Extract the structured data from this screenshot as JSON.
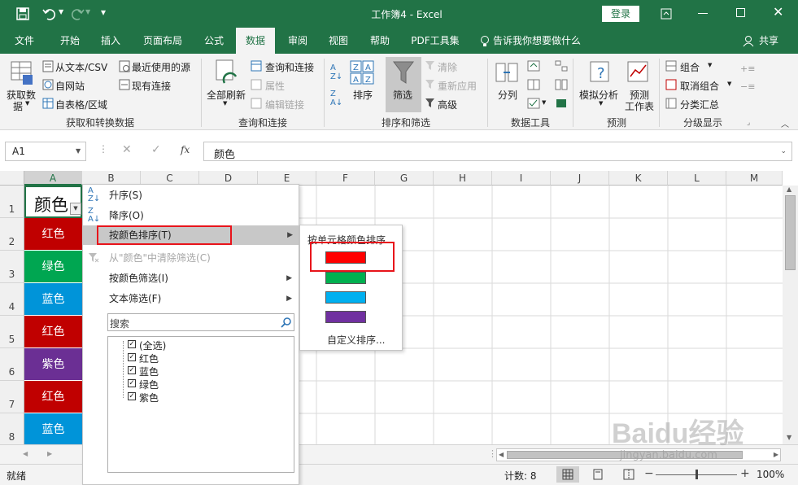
{
  "titlebar": {
    "title": "工作簿4 - Excel",
    "login": "登录"
  },
  "tabs": [
    "文件",
    "开始",
    "插入",
    "页面布局",
    "公式",
    "数据",
    "审阅",
    "视图",
    "帮助",
    "PDF工具集"
  ],
  "tell_me": "告诉我你想要做什么",
  "share": "共享",
  "ribbon": {
    "get_data": "获取数",
    "get_data2": "据",
    "from_text": "从文本/CSV",
    "from_web": "自网站",
    "from_table": "自表格/区域",
    "recent": "最近使用的源",
    "existing": "现有连接",
    "group1": "获取和转换数据",
    "refresh_all": "全部刷新",
    "queries": "查询和连接",
    "properties": "属性",
    "edit_links": "编辑链接",
    "group2": "查询和连接",
    "sort": "排序",
    "filter": "筛选",
    "clear": "清除",
    "reapply": "重新应用",
    "advanced": "高级",
    "group3": "排序和筛选",
    "split": "分列",
    "group4": "数据工具",
    "whatif": "模拟分析",
    "forecast": "预测",
    "forecast_sheet": "工作表",
    "group5": "预测",
    "group_btn": "组合",
    "ungroup": "取消组合",
    "subtotal": "分类汇总",
    "group6": "分级显示"
  },
  "formula_bar": {
    "name_box": "A1",
    "fx": "fx",
    "content": "颜色"
  },
  "columns": [
    "A",
    "B",
    "C",
    "D",
    "E",
    "F",
    "G",
    "H",
    "I",
    "J",
    "K",
    "L",
    "M"
  ],
  "rows": [
    "1",
    "2",
    "3",
    "4",
    "5",
    "6",
    "7",
    "8"
  ],
  "cells_a": [
    {
      "text": "颜色",
      "color": "#ffffff"
    },
    {
      "text": "红色",
      "color": "#c00000"
    },
    {
      "text": "绿色",
      "color": "#00a651"
    },
    {
      "text": "蓝色",
      "color": "#0094d9"
    },
    {
      "text": "红色",
      "color": "#c00000"
    },
    {
      "text": "紫色",
      "color": "#6b2f94"
    },
    {
      "text": "红色",
      "color": "#c00000"
    },
    {
      "text": "蓝色",
      "color": "#0094d9"
    }
  ],
  "menu": {
    "sort_asc": "升序(S)",
    "sort_desc": "降序(O)",
    "sort_by_color": "按颜色排序(T)",
    "clear_filter": "从\"颜色\"中清除筛选(C)",
    "filter_by_color": "按颜色筛选(I)",
    "text_filter": "文本筛选(F)",
    "search_placeholder": "搜索",
    "items": [
      "(全选)",
      "红色",
      "蓝色",
      "绿色",
      "紫色"
    ]
  },
  "submenu": {
    "title": "按单元格颜色排序",
    "swatches": [
      "#ff0000",
      "#00b050",
      "#00b0f0",
      "#7030a0"
    ],
    "custom": "自定义排序..."
  },
  "status": {
    "ready": "就绪",
    "count": "计数: 8",
    "zoom": "100%"
  },
  "watermark": "Baidu经验",
  "watermark_url": "jingyan.baidu.com"
}
